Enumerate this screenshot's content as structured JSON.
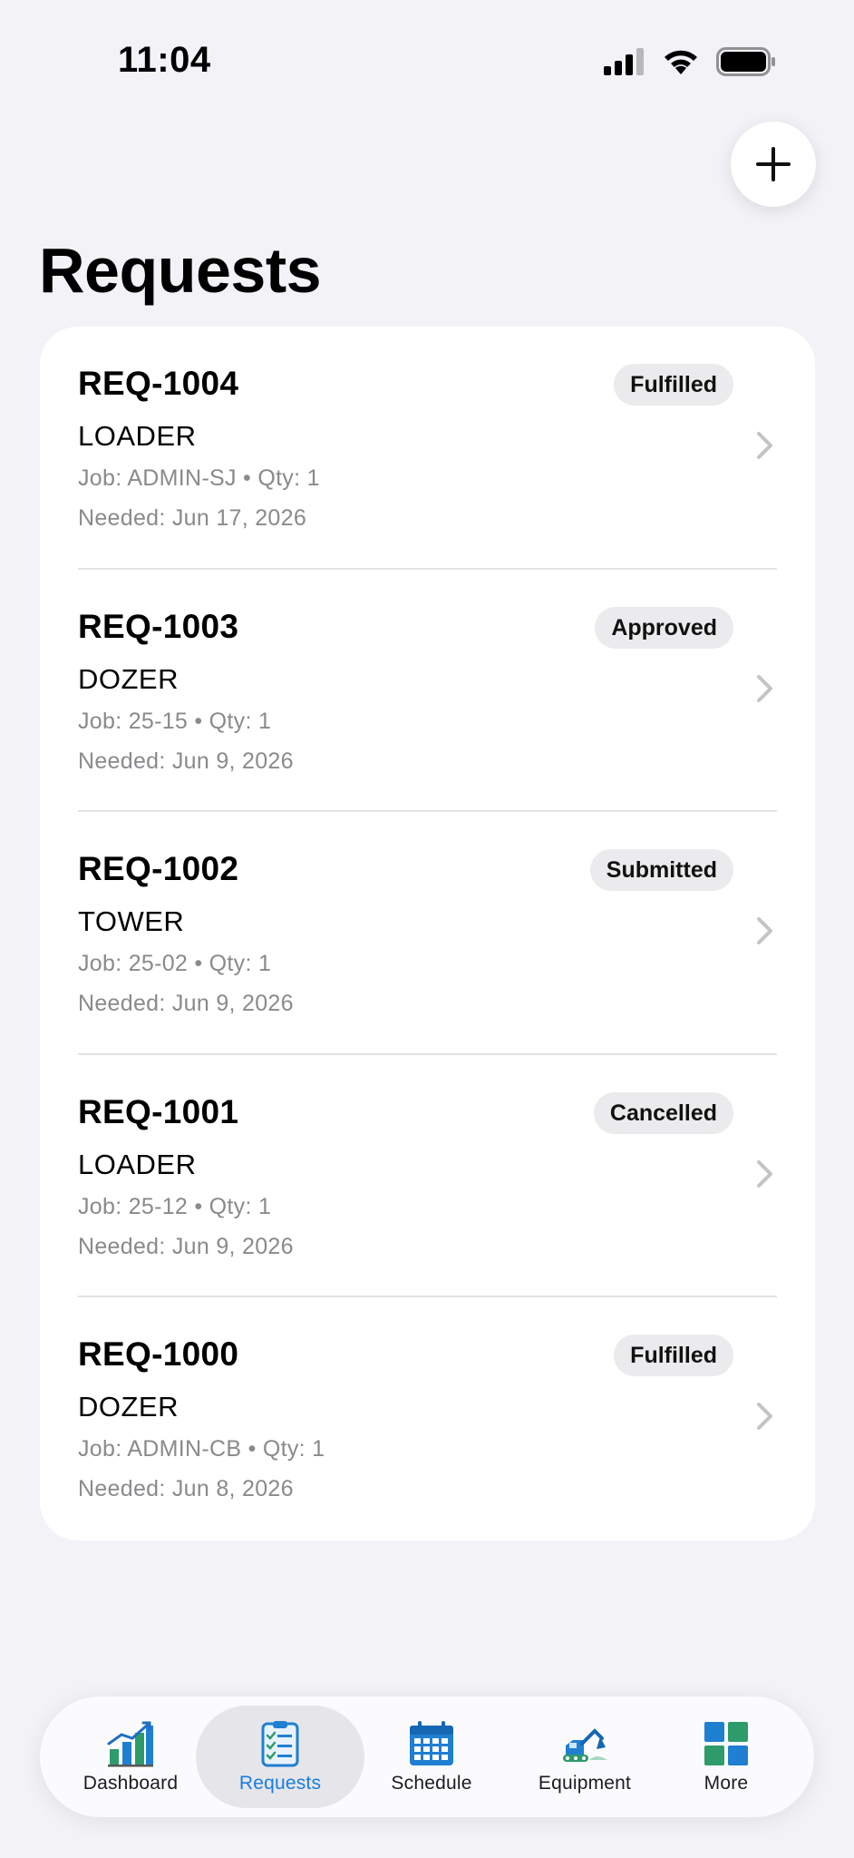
{
  "status_bar": {
    "time": "11:04"
  },
  "header": {
    "title": "Requests",
    "add_icon": "plus-icon"
  },
  "requests": [
    {
      "id": "REQ-1004",
      "type": "LOADER",
      "meta": "Job: ADMIN-SJ • Qty: 1",
      "needed": "Needed: Jun 17, 2026",
      "status": "Fulfilled"
    },
    {
      "id": "REQ-1003",
      "type": "DOZER",
      "meta": "Job: 25-15 • Qty: 1",
      "needed": "Needed: Jun 9, 2026",
      "status": "Approved"
    },
    {
      "id": "REQ-1002",
      "type": "TOWER",
      "meta": "Job: 25-02 • Qty: 1",
      "needed": "Needed: Jun 9, 2026",
      "status": "Submitted"
    },
    {
      "id": "REQ-1001",
      "type": "LOADER",
      "meta": "Job: 25-12 • Qty: 1",
      "needed": "Needed: Jun 9, 2026",
      "status": "Cancelled"
    },
    {
      "id": "REQ-1000",
      "type": "DOZER",
      "meta": "Job: ADMIN-CB • Qty: 1",
      "needed": "Needed: Jun 8, 2026",
      "status": "Fulfilled"
    }
  ],
  "tab_bar": {
    "active": "Requests",
    "accent_color": "#1a7de0",
    "tabs": [
      {
        "label": "Dashboard",
        "icon": "bar-chart-icon"
      },
      {
        "label": "Requests",
        "icon": "clipboard-checklist-icon"
      },
      {
        "label": "Schedule",
        "icon": "calendar-icon"
      },
      {
        "label": "Equipment",
        "icon": "excavator-icon"
      },
      {
        "label": "More",
        "icon": "grid-icon"
      }
    ]
  }
}
